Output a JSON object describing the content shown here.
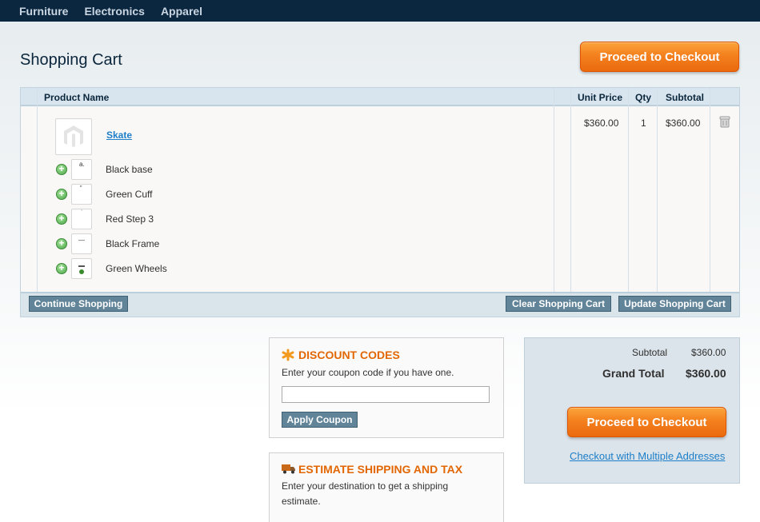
{
  "nav": {
    "items": [
      "Furniture",
      "Electronics",
      "Apparel"
    ]
  },
  "page_title": "Shopping Cart",
  "checkout_button_label": "Proceed to Checkout",
  "table": {
    "headers": {
      "product": "Product Name",
      "unit_price": "Unit Price",
      "qty": "Qty",
      "subtotal": "Subtotal"
    },
    "product": {
      "name": "Skate",
      "unit_price": "$360.00",
      "qty": "1",
      "subtotal": "$360.00"
    },
    "options": [
      "Black base",
      "Green Cuff",
      "Red Step 3",
      "Black Frame",
      "Green Wheels"
    ]
  },
  "actions": {
    "continue": "Continue Shopping",
    "clear": "Clear Shopping Cart",
    "update": "Update Shopping Cart"
  },
  "discount": {
    "title": "DISCOUNT CODES",
    "text": "Enter your coupon code if you have one.",
    "input_value": "",
    "apply": "Apply Coupon"
  },
  "shipping": {
    "title": "ESTIMATE SHIPPING AND TAX",
    "text": "Enter your destination to get a shipping estimate."
  },
  "totals": {
    "subtotal_label": "Subtotal",
    "subtotal_value": "$360.00",
    "grand_label": "Grand Total",
    "grand_value": "$360.00",
    "multi_link": "Checkout with Multiple Addresses"
  },
  "icons": {
    "option_add": "plus-circle-icon",
    "remove": "trash-icon",
    "discount": "asterisk-icon",
    "shipping": "truck-icon",
    "product_image": "magento-logo-icon"
  },
  "colors": {
    "nav_bg": "#0b2740",
    "checkout_orange": "#f4801e",
    "link_blue": "#1e7ec8",
    "section_title": "#e26703",
    "button_blue_gray": "#618499"
  }
}
